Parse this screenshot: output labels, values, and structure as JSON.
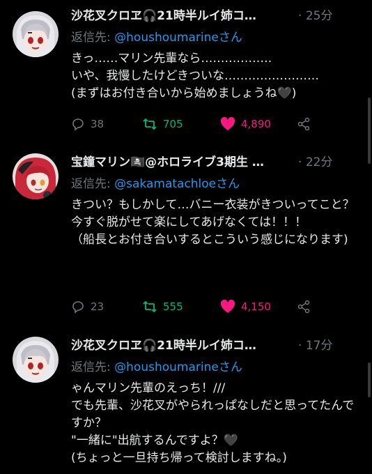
{
  "tweets": [
    {
      "name": "沙花叉クロヱ🎧21時半ルイ姉コ…",
      "time": "25分",
      "reply_prefix": "返信先:",
      "reply_handle": "@houshoumarineさん",
      "body": "きっ……マリン先輩なら………………\nいや、我慢したけどきついな……………………\n(まずはお付き合いから始めましょうね🖤)",
      "replies": "38",
      "retweets": "705",
      "likes": "4,890"
    },
    {
      "name": "宝鐘マリン🏴‍☠️@ホロライブ3期生 …",
      "time": "22分",
      "reply_prefix": "返信先:",
      "reply_handle": "@sakamatachloeさん",
      "body": "きつい？もしかして…バニー衣装がきついってこと？\n今すぐ脱がせて楽にしてあげなくては！！！\n（船長とお付き合いするとこういう感じになります)",
      "replies": "23",
      "retweets": "555",
      "likes": "4,150"
    },
    {
      "name": "沙花叉クロヱ🎧21時半ルイ姉コ…",
      "time": "17分",
      "reply_prefix": "返信先:",
      "reply_handle": "@houshoumarineさん",
      "body": "ゃんマリン先輩のえっち！///\nでも先輩、沙花叉がやられっぱなしだと思ってたんですか？\n\"一緒に\"出航するんですよ？🖤\n(ちょっと一旦持ち帰って検討しますね。)"
    }
  ],
  "colors": {
    "background": "#000000",
    "text": "#e7e9ea",
    "muted": "#71767b",
    "link": "#1d9bf0",
    "retweet": "#00ba7c",
    "like": "#f91880"
  }
}
